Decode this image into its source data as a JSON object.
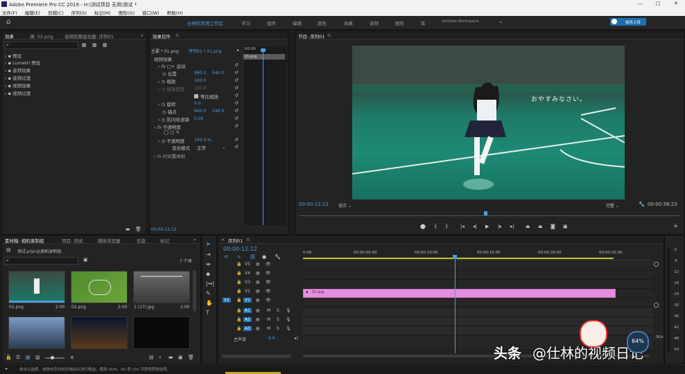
{
  "app": {
    "title": "Adobe Premiere Pro CC 2019 - H:\\测试项目 无用\\测试 *",
    "win_min": "—",
    "win_max": "□",
    "win_close": "✕"
  },
  "menu": [
    "文件(F)",
    "编辑(E)",
    "剪辑(C)",
    "序列(S)",
    "标记(M)",
    "图形(G)",
    "窗口(W)",
    "帮助(H)"
  ],
  "workspaces": [
    "仕林的常用工作区",
    "学习",
    "组件",
    "编辑",
    "颜色",
    "效果",
    "音频",
    "图形",
    "库",
    "Untitled Workspace"
  ],
  "workspace_more": "»",
  "upload_btn": "拍传上传",
  "effects_panel": {
    "tabs": [
      "效果",
      "源: 02.png",
      "音频剪辑混合器: 序列01"
    ],
    "more": "»",
    "items": [
      "预设",
      "Lumetri 预设",
      "音频效果",
      "音频过渡",
      "视频效果",
      "视频过渡"
    ]
  },
  "effect_controls": {
    "tab": "效果控件",
    "menu_icon": "≡",
    "master": "主要 * 01.png",
    "sequence": "序列01 * 01.png",
    "time_header": "00:00",
    "clip_name": "01.png",
    "section": "视频效果",
    "fx_motion": "运动",
    "position_label": "位置",
    "position_x": "960.0",
    "position_y": "540.0",
    "scale_label": "缩放",
    "scale": "100.0",
    "scale_width_label": "缩放宽度",
    "scale_width": "100.0",
    "uniform_label": "等比缩放",
    "rotation_label": "旋转",
    "rotation": "0.0",
    "anchor_label": "锚点",
    "anchor_x": "960.0",
    "anchor_y": "540.0",
    "antiflicker_label": "防闪烁滤镜",
    "antiflicker": "0.00",
    "opacity_section": "不透明度",
    "opacity_label": "不透明度",
    "opacity": "100.0 %",
    "blend_label": "混合模式",
    "blend": "正常",
    "timeremap": "时间重映射",
    "current_time": "00:00:12:12"
  },
  "program": {
    "tab": "节目: 序列01",
    "menu_icon": "≡",
    "overlay_text": "おやすみなさい。",
    "timecode": "00:00:12:12",
    "fit": "适合",
    "quality": "完整",
    "duration": "00:00:38:23"
  },
  "project": {
    "tabs": [
      "素材箱: 相机录制组",
      "项目: 测试",
      "媒体浏览器",
      "信息",
      "标记"
    ],
    "more": "»",
    "path": "测试.prproj\\相机录制组",
    "count": "7 个项",
    "clips": [
      {
        "name": "01.png",
        "dur": "2:00"
      },
      {
        "name": "02.png",
        "dur": "2:00"
      },
      {
        "name": "1 (17).jpg",
        "dur": "2:00"
      }
    ]
  },
  "sequence": {
    "tab": "序列01",
    "timecode": "00:00:12:12",
    "ruler": [
      "0:00",
      "00:00:05:00",
      "00:00:10:00",
      "00:00:15:00",
      "00:00:20:00",
      "00:00:25:00"
    ],
    "video_tracks": [
      "V5",
      "V4",
      "V3",
      "V2",
      "V1"
    ],
    "audio_tracks": [
      "A1",
      "A2",
      "A3"
    ],
    "master": "主声道",
    "master_val": "0.0",
    "clip_label": "01.png"
  },
  "meter_scale": [
    "0",
    "-6",
    "-12",
    "-18",
    "-24",
    "-30",
    "-36",
    "-42",
    "-48",
    "-54"
  ],
  "status": "单击以选择，或单击空白处并拖动以进行框选。使用 Shift、Alt 和 Ctrl 可获得其他选项。",
  "watermark": {
    "left": "头条",
    "right": "@仕林的视频日记",
    "badge": "64%",
    "speed1": "0K/s",
    "speed2": "0K/s"
  },
  "colors": {
    "accent": "#4a9ee0",
    "clip": "#e58ee0",
    "playhead": "#4a9ee0"
  }
}
